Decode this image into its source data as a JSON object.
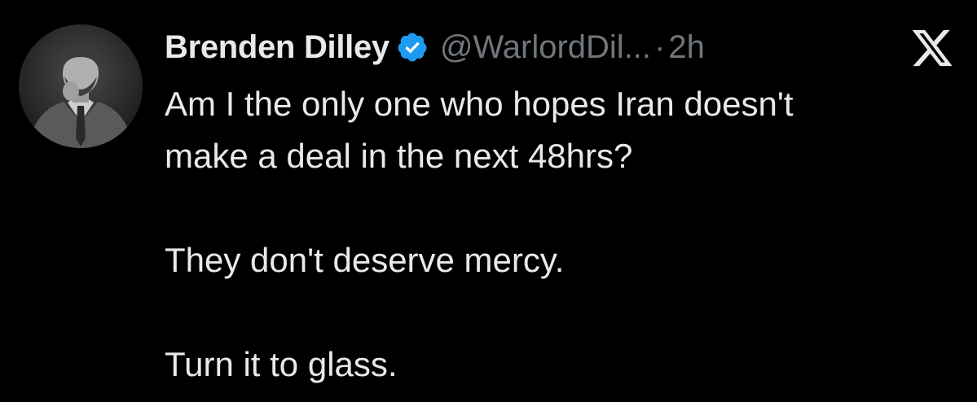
{
  "author": {
    "display_name": "Brenden Dilley",
    "handle": "@WarlordDil...",
    "separator": "·",
    "timestamp": "2h",
    "verified_color": "#1d9bf0"
  },
  "tweet": {
    "lines": [
      "Am I the only one who hopes Iran doesn't",
      "make a deal in the next 48hrs?",
      "They don't deserve mercy.",
      "Turn it to glass."
    ]
  },
  "icons": {
    "verified": "verified-badge-icon",
    "brand": "x-logo-icon",
    "avatar": "profile-photo"
  }
}
